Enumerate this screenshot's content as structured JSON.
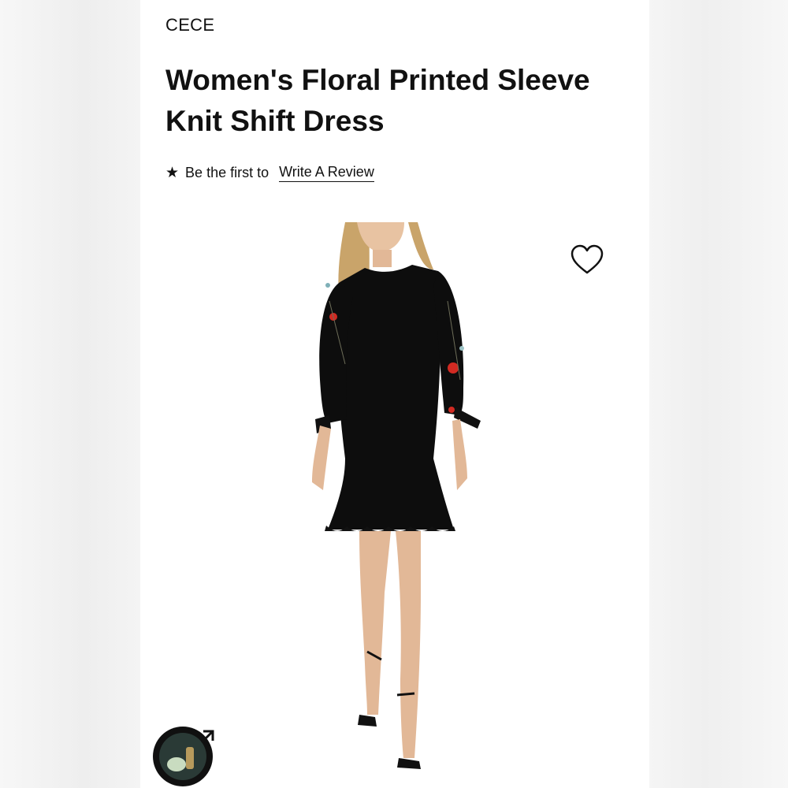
{
  "product": {
    "brand": "CECE",
    "title": "Women's Floral Printed Sleeve Knit Shift Dress",
    "review_prefix": "Be the first to",
    "review_link": "Write A Review"
  },
  "icons": {
    "rating": "star-icon",
    "wishlist": "heart-icon",
    "promo": "external-link-icon"
  },
  "colors": {
    "dress": "#0d0d0d",
    "flower": "#d12a22",
    "background": "#ffffff"
  }
}
